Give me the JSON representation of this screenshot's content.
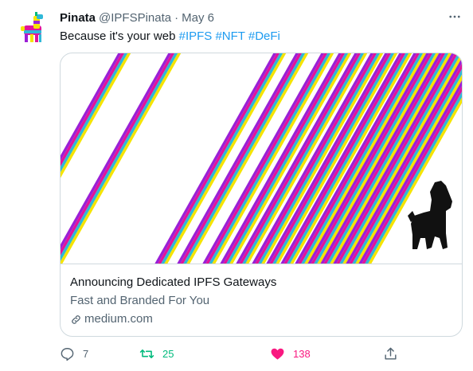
{
  "tweet": {
    "author_name": "Pinata",
    "handle": "@IPFSPinata",
    "separator": "·",
    "date": "May 6",
    "text_prefix": "Because it's your web ",
    "hashtags": [
      "#IPFS",
      "#NFT",
      "#DeFi"
    ]
  },
  "card": {
    "title": "Announcing Dedicated IPFS Gateways",
    "description": "Fast and Branded For You",
    "domain": "medium.com"
  },
  "actions": {
    "replies": "7",
    "retweets": "25",
    "likes": "138"
  },
  "icons": {
    "avatar": "pinata-llama-logo",
    "more": "more-horizontal-icon",
    "reply": "reply-icon",
    "retweet": "retweet-icon",
    "like": "heart-filled-icon",
    "share": "share-icon",
    "link": "link-icon"
  },
  "colors": {
    "hashtag": "#1d9bf0",
    "retweet_active": "#00ba7c",
    "like_active": "#f91880",
    "stripe_purple": "#9b1fd6",
    "stripe_magenta": "#e0149b",
    "stripe_cyan": "#2fb8d8",
    "stripe_yellow": "#f5e400"
  }
}
